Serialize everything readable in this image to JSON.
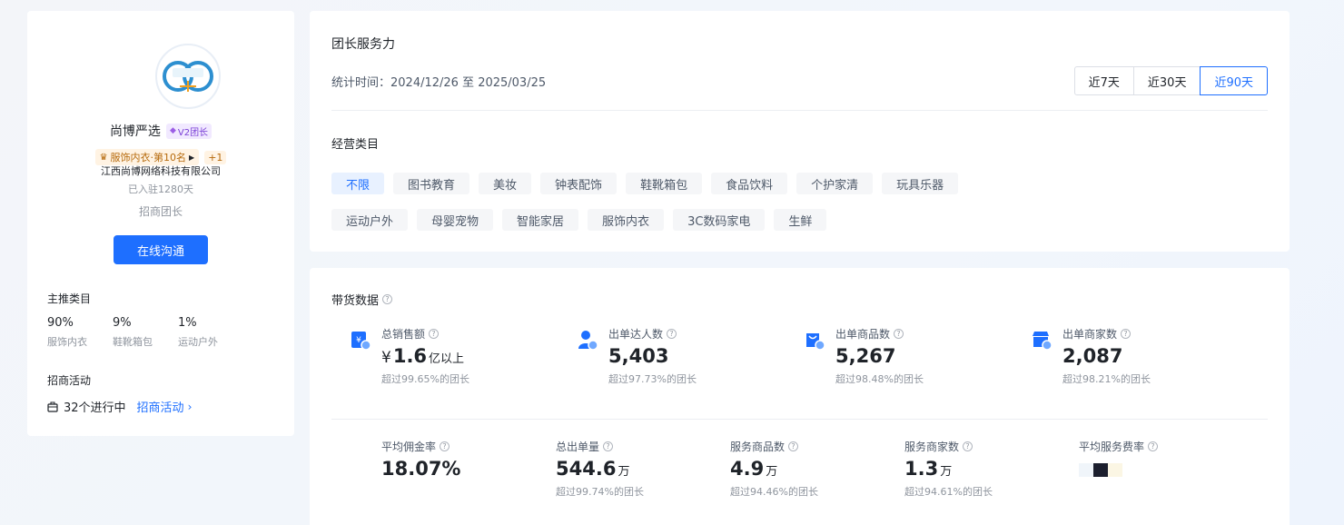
{
  "profile": {
    "logo_text": "尚博严选",
    "name": "尚博严选",
    "level": "V2团长",
    "rank": "服饰内衣·第10名",
    "rank_extra": "+1",
    "company": "江西尚博网络科技有限公司",
    "joined": "已入驻1280天",
    "role": "招商团长",
    "chat_button": "在线沟通",
    "main_categories_title": "主推类目",
    "main_categories": [
      {
        "pct": "90%",
        "name": "服饰内衣"
      },
      {
        "pct": "9%",
        "name": "鞋靴箱包"
      },
      {
        "pct": "1%",
        "name": "运动户外"
      }
    ],
    "activity_title": "招商活动",
    "activity_count": "32个进行中",
    "activity_link": "招商活动"
  },
  "service": {
    "title": "团长服务力",
    "period": "统计时间：2024/12/26 至 2025/03/25",
    "ranges": [
      "近7天",
      "近30天",
      "近90天"
    ],
    "active_range": "近90天",
    "category_title": "经营类目",
    "chips_row1": [
      "不限",
      "图书教育",
      "美妆",
      "钟表配饰",
      "鞋靴箱包",
      "食品饮料",
      "个护家清",
      "玩具乐器"
    ],
    "chips_row2": [
      "运动户外",
      "母婴宠物",
      "智能家居",
      "服饰内衣",
      "3C数码家电",
      "生鲜"
    ],
    "active_chip": "不限"
  },
  "sales": {
    "title": "带货数据",
    "primary": [
      {
        "label": "总销售额",
        "currency": "¥",
        "value": "1.6",
        "unit": "亿以上",
        "sub": "超过99.65%的团长",
        "icon": "sales-icon",
        "color": "#1e6fff"
      },
      {
        "label": "出单达人数",
        "value": "5,403",
        "unit": "",
        "sub": "超过97.73%的团长",
        "icon": "influencer-icon",
        "color": "#1e6fff"
      },
      {
        "label": "出单商品数",
        "value": "5,267",
        "unit": "",
        "sub": "超过98.48%的团长",
        "icon": "product-icon",
        "color": "#1e6fff"
      },
      {
        "label": "出单商家数",
        "value": "2,087",
        "unit": "",
        "sub": "超过98.21%的团长",
        "icon": "merchant-icon",
        "color": "#1e6fff"
      }
    ],
    "secondary": [
      {
        "label": "平均佣金率",
        "value": "18.07%",
        "unit": "",
        "sub": ""
      },
      {
        "label": "总出单量",
        "value": "544.6",
        "unit": "万",
        "sub": "超过99.74%的团长"
      },
      {
        "label": "服务商品数",
        "value": "4.9",
        "unit": "万",
        "sub": "超过94.46%的团长"
      },
      {
        "label": "服务商家数",
        "value": "1.3",
        "unit": "万",
        "sub": "超过94.61%的团长"
      },
      {
        "label": "平均服务费率",
        "value": "",
        "unit": "",
        "sub": ""
      }
    ],
    "swatch_colors": [
      "#f0f5fa",
      "#1c1f2e",
      "#fbf6e4"
    ]
  }
}
